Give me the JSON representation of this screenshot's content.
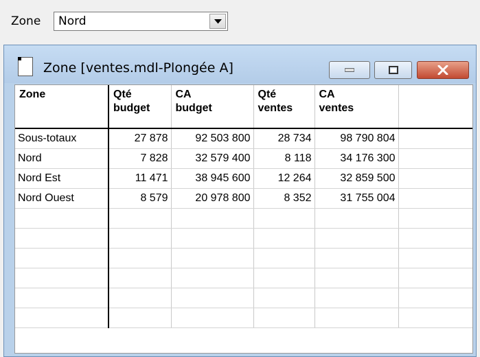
{
  "zone_selector": {
    "label": "Zone",
    "value": "Nord"
  },
  "window": {
    "title": "Zone [ventes.mdl-Plongée A]"
  },
  "table": {
    "headers": [
      [
        "Zone"
      ],
      [
        "Qté",
        "budget"
      ],
      [
        "CA",
        "budget"
      ],
      [
        "Qté",
        "ventes"
      ],
      [
        "CA",
        "ventes"
      ]
    ],
    "rows": [
      [
        "Sous-totaux",
        "27 878",
        "92 503 800",
        "28 734",
        "98 790 804"
      ],
      [
        "Nord",
        "7 828",
        "32 579 400",
        "8 118",
        "34 176 300"
      ],
      [
        "Nord Est",
        "11 471",
        "38 945 600",
        "12 264",
        "32 859 500"
      ],
      [
        "Nord Ouest",
        "8 579",
        "20 978 800",
        "8 352",
        "31 755 004"
      ]
    ],
    "empty_rows": 6
  }
}
